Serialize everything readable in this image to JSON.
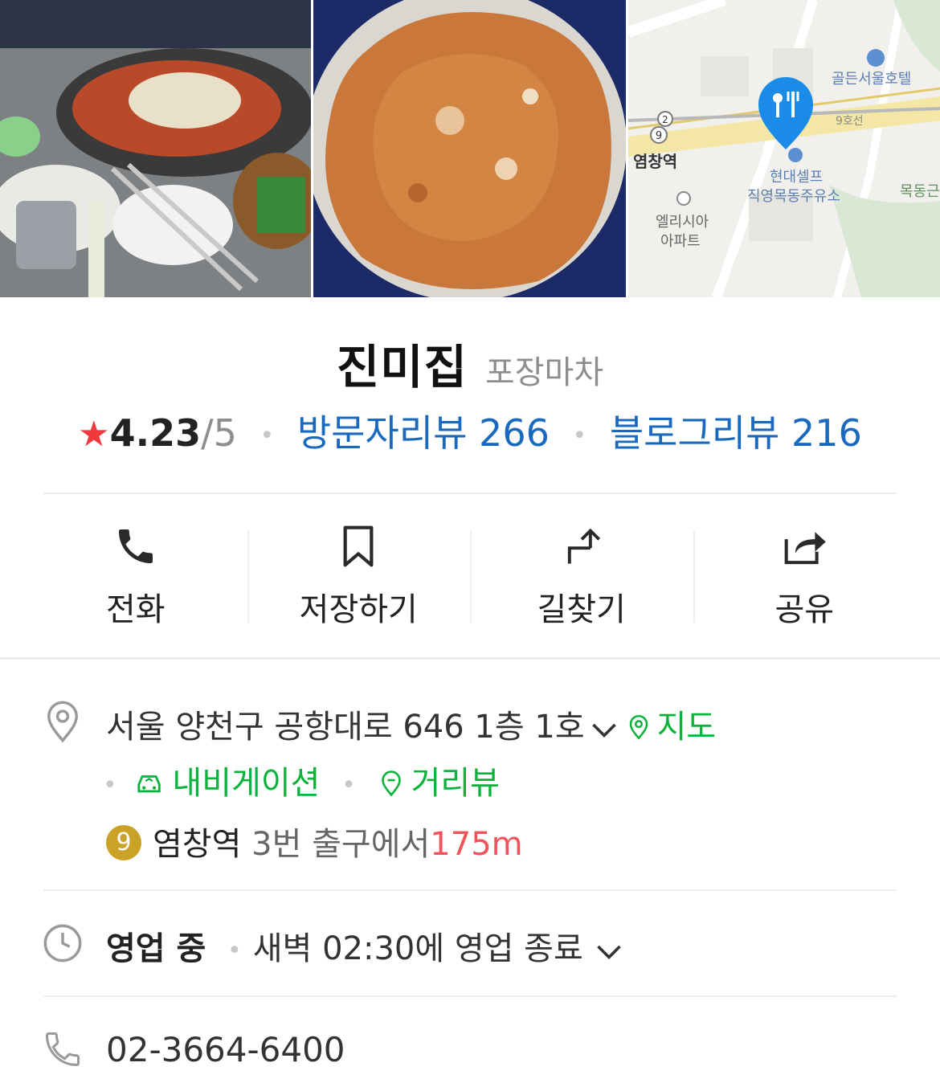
{
  "place": {
    "name": "진미집",
    "category": "포장마차"
  },
  "rating": {
    "star": "★",
    "score": "4.23",
    "out_of": "/5",
    "visitor_reviews": "방문자리뷰 266",
    "blog_reviews": "블로그리뷰 216"
  },
  "actions": [
    {
      "label": "전화",
      "icon": "phone-icon"
    },
    {
      "label": "저장하기",
      "icon": "bookmark-icon"
    },
    {
      "label": "길찾기",
      "icon": "directions-icon"
    },
    {
      "label": "공유",
      "icon": "share-icon"
    }
  ],
  "address": {
    "text": "서울 양천구 공항대로 646 1층 1호",
    "map_link": "지도",
    "navigation_link": "내비게이션",
    "street_view_link": "거리뷰"
  },
  "subway": {
    "line": "9",
    "station": "염창역",
    "exit": "3번 출구에서",
    "distance": "175m"
  },
  "hours": {
    "status": "영업 중",
    "detail": "새벽 02:30에 영업 종료"
  },
  "phone": "02-3664-6400",
  "map_thumbnail": {
    "labels": [
      "골든서울호텔",
      "9호선",
      "염창역",
      "현대셀프",
      "직영목동주유소",
      "엘리시아",
      "아파트",
      "목동근"
    ]
  },
  "colors": {
    "accent_blue": "#1969bf",
    "green": "#0bb33c",
    "star_red": "#f0383d",
    "distance_red": "#f0545a",
    "subway_line9": "#c9a227",
    "map_pin": "#1a8ce8"
  }
}
